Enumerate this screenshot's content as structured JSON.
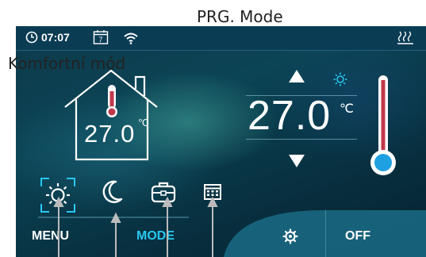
{
  "annotations": {
    "top_label": "PRG. Mode",
    "left_label": "Komfortní mód"
  },
  "status_bar": {
    "time": "07:07",
    "calendar_day": "7",
    "icons": [
      "clock-icon",
      "calendar-icon",
      "wifi-icon",
      "heating-icon"
    ]
  },
  "room": {
    "temperature": "27.0",
    "unit": "℃",
    "icons": [
      "house-icon",
      "thermometer-icon"
    ]
  },
  "setpoint": {
    "temperature": "27.0",
    "unit": "℃",
    "active_mode_icon": "sun-icon",
    "icons": [
      "arrow-up-icon",
      "arrow-down-icon",
      "thermometer-slider-icon"
    ]
  },
  "modes": {
    "items": [
      {
        "name": "comfort",
        "icon": "sun-icon",
        "selected": true
      },
      {
        "name": "night",
        "icon": "moon-icon",
        "selected": false
      },
      {
        "name": "away",
        "icon": "briefcase-icon",
        "selected": false
      },
      {
        "name": "program",
        "icon": "calendar-icon",
        "selected": false
      }
    ]
  },
  "bottom_bar": {
    "menu_label": "MENU",
    "mode_label": "MODE",
    "off_label": "OFF",
    "settings_icon": "gear-icon"
  },
  "colors": {
    "accent": "#28c8f0",
    "text": "#ffffff",
    "thermo_fill": "#c0394b",
    "thermo_bulb": "#1fa0e0"
  }
}
